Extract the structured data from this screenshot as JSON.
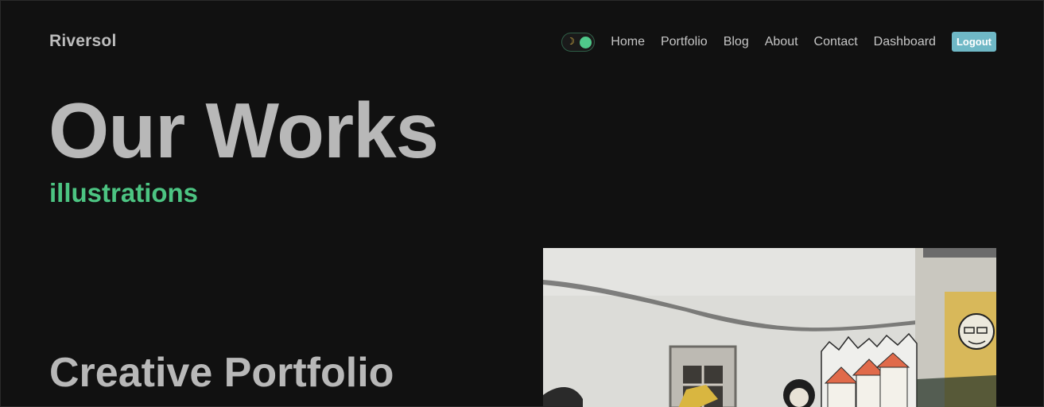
{
  "nav": {
    "brand": "Riversol",
    "theme_toggle_icon": "moon-icon",
    "links": [
      "Home",
      "Portfolio",
      "Blog",
      "About",
      "Contact",
      "Dashboard"
    ],
    "logout_label": "Logout"
  },
  "hero": {
    "title": "Our Works",
    "subtitle": "illustrations"
  },
  "section": {
    "title": "Creative Portfolio"
  },
  "colors": {
    "background": "#111111",
    "accent_green": "#4cc482",
    "logout_button": "#6fb8c6",
    "text": "#b8b8b8"
  }
}
